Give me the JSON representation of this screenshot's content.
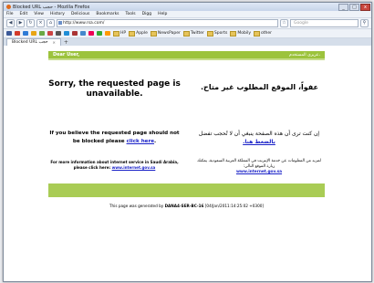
{
  "window": {
    "title": "Blocked URL حجب - Mozilla Firefox",
    "controls": [
      "_",
      "□",
      "x"
    ]
  },
  "menu": [
    "File",
    "Edit",
    "View",
    "History",
    "Delicious",
    "Bookmarks",
    "Tools",
    "Digg",
    "Help"
  ],
  "nav": {
    "url": "http://www.rsa.com/",
    "search_placeholder": "Google"
  },
  "bookmarks": [
    {
      "label": "HP"
    },
    {
      "label": "Apple"
    },
    {
      "label": "NewsPaper"
    },
    {
      "label": "Twitter"
    },
    {
      "label": "Sports"
    },
    {
      "label": "Mobily"
    },
    {
      "label": "other"
    }
  ],
  "tab": {
    "label": "Blocked URL حجب"
  },
  "page": {
    "header_en": "Dear User,",
    "header_ar": "عزيزي المستخدم،",
    "sorry_en": "Sorry, the requested page is unavailable.",
    "sorry_ar": "عفواً، الموقع المطلوب غير متاح.",
    "believe_en": "If you believe the requested page should not be blocked please",
    "believe_link": "click here",
    "believe_end": ".",
    "believe_ar": "إن كنت ترى أن هذه الصفحة ينبغي أن لا تُحجب تفضل",
    "believe_ar_link": "بالضغط هنا.",
    "info_en": "For more information about internet service in Saudi Arabia, please click here:",
    "info_link": "www.internet.gov.sa",
    "info_ar": "لمزيد من المعلومات عن خدمة الإنترنت في المملكة العربية السعودية، يمكنك زيارة الموقع التالي:",
    "info_ar_link": "www.internet.gov.sa",
    "footer_pre": "This page was generated by",
    "footer_host": "DANA4-SER-BC-16",
    "footer_time": "[04/Jan/2011:14:25:02 +0300]"
  }
}
